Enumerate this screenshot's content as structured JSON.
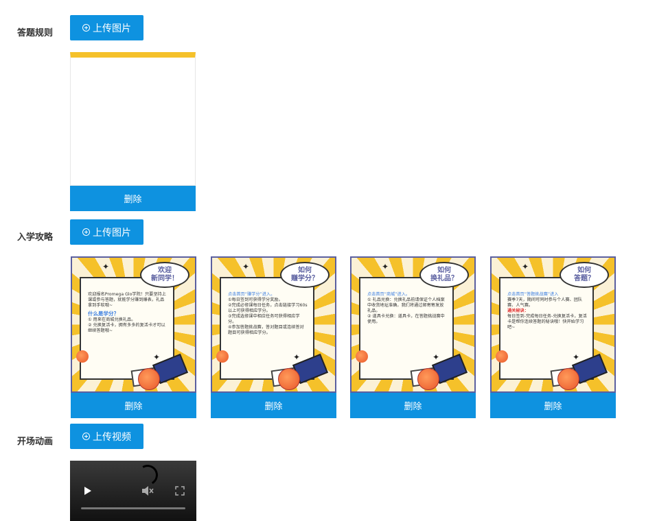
{
  "sections": [
    {
      "label": "答题规则",
      "upload_label": "上传图片",
      "delete_label": "删除"
    },
    {
      "label": "入学攻略",
      "upload_label": "上传图片",
      "delete_label": "删除",
      "posters": [
        {
          "bubble": "欢迎\n新同学！",
          "lines": [
            {
              "t": "欢迎报名Promega Glo学院！只要坚持上课或参与答题，就能学分赚到爆表，礼品拿到手软哦~",
              "c": ""
            },
            {
              "t": "什么是学分？",
              "c": "hd"
            },
            {
              "t": "① 用来在商城兑换礼品。",
              "c": ""
            },
            {
              "t": "② 兑换复活卡，拥有多多的复活卡才可以继续答题哦~",
              "c": ""
            }
          ]
        },
        {
          "bubble": "如何\n赚学分？",
          "lines": [
            {
              "t": "点击首页“赚学分”进入。",
              "c": "blue"
            },
            {
              "t": "①每日签到可获得学分奖励。",
              "c": ""
            },
            {
              "t": "②完成必修课每日任务，点击链接学习60s以上可获得相应学分。",
              "c": ""
            },
            {
              "t": "③完成选修课中相应任务可获得相应学分。",
              "c": ""
            },
            {
              "t": "④参加答题挑战赛，答对题目或连续答对题目可获得相应学分。",
              "c": ""
            }
          ]
        },
        {
          "bubble": "如何\n换礼品？",
          "lines": [
            {
              "t": "点击首页“商城”进入。",
              "c": "blue"
            },
            {
              "t": "① 礼品兑换：兑换礼品前请保证个人档案中收货地址准确，我们将通过邮寄寄发放礼品。",
              "c": ""
            },
            {
              "t": "② 道具卡兑换：道具卡，在答题挑战赛中使用。",
              "c": ""
            }
          ]
        },
        {
          "bubble": "如何\n答题？",
          "lines": [
            {
              "t": "点击首页“答题挑战赛”进入",
              "c": "blue"
            },
            {
              "t": "赛季7天，期间可同时参与个人赛、团队赛、人气赛。",
              "c": ""
            },
            {
              "t": "通关秘诀：",
              "c": "red"
            },
            {
              "t": "每日签到-完成每日任务-兑换复活卡，复活卡是帮你连续答题的秘诀哦！快开始学习吧~",
              "c": ""
            }
          ]
        }
      ]
    },
    {
      "label": "开场动画",
      "upload_label": "上传视频"
    }
  ],
  "colors": {
    "primary": "#0e92e0",
    "label_text": "#333333",
    "poster_frame": "#5a5fa0",
    "poster_yellow": "#f5c12a"
  },
  "icons": {
    "upload": "plus-circle-icon",
    "play": "play-icon",
    "volume": "volume-icon",
    "fullscreen": "fullscreen-icon"
  }
}
